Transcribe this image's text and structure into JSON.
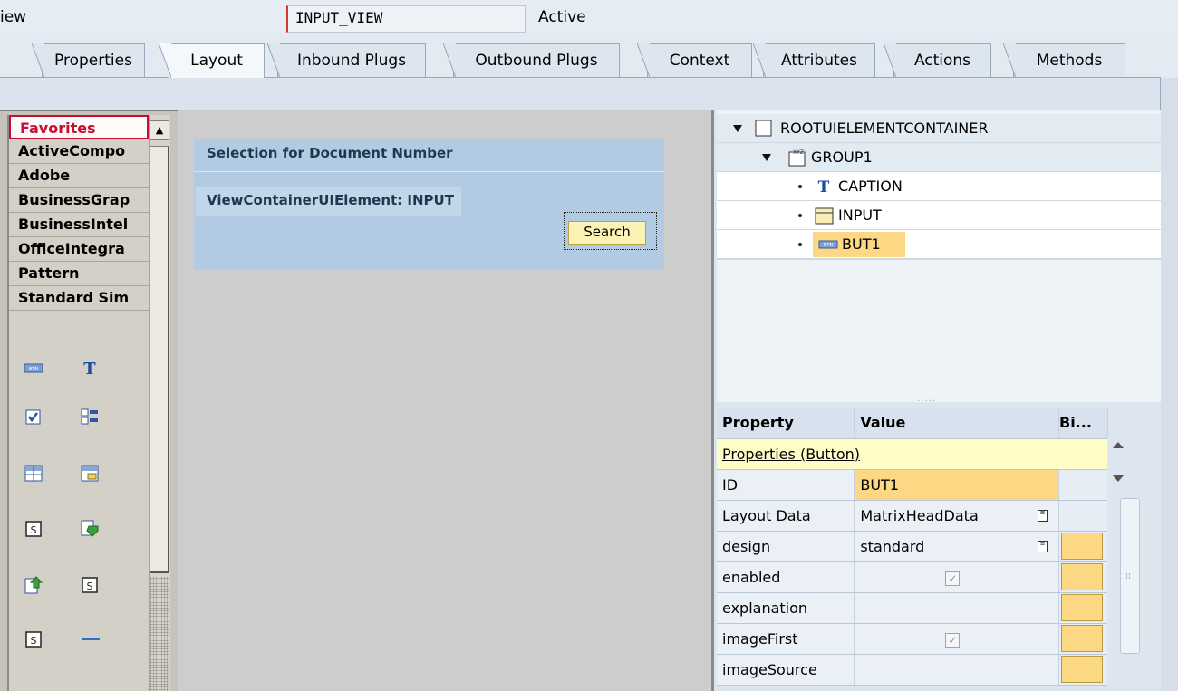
{
  "header": {
    "view_label": "iew",
    "view_name": "INPUT_VIEW",
    "status": "Active"
  },
  "tabs": [
    {
      "label": "Properties"
    },
    {
      "label": "Layout"
    },
    {
      "label": "Inbound Plugs"
    },
    {
      "label": "Outbound Plugs"
    },
    {
      "label": "Context"
    },
    {
      "label": "Attributes"
    },
    {
      "label": "Actions"
    },
    {
      "label": "Methods"
    }
  ],
  "active_tab": "Layout",
  "palette": {
    "categories": [
      {
        "label": "Favorites"
      },
      {
        "label": "ActiveCompo"
      },
      {
        "label": "Adobe"
      },
      {
        "label": "BusinessGrap"
      },
      {
        "label": "BusinessIntel"
      },
      {
        "label": "OfficeIntegra"
      },
      {
        "label": "Pattern"
      },
      {
        "label": "Standard Sim"
      }
    ],
    "icons": [
      "button-icon",
      "textview-icon",
      "checkbox-icon",
      "checkbox-group-icon",
      "table-icon",
      "tree-table-icon",
      "script-icon",
      "download-icon",
      "upload-icon",
      "script-icon",
      "script-icon",
      "separator-icon"
    ]
  },
  "canvas": {
    "group_title": "Selection for Document Number",
    "container_label": "ViewContainerUIElement: INPUT",
    "button_label": "Search"
  },
  "tree": {
    "nodes": [
      {
        "label": "ROOTUIELEMENTCONTAINER",
        "icon": "container-icon"
      },
      {
        "label": "GROUP1",
        "icon": "group-icon"
      },
      {
        "label": "CAPTION",
        "icon": "caption-icon"
      },
      {
        "label": "INPUT",
        "icon": "viewcontainer-icon"
      },
      {
        "label": "BUT1",
        "icon": "button-icon"
      }
    ],
    "selected": "BUT1"
  },
  "properties": {
    "headers": {
      "property": "Property",
      "value": "Value",
      "binding": "Bi..."
    },
    "section": "Properties (Button)",
    "rows": [
      {
        "property": "ID",
        "value": "BUT1"
      },
      {
        "property": "Layout Data",
        "value": "MatrixHeadData"
      },
      {
        "property": "design",
        "value": "standard"
      },
      {
        "property": "enabled",
        "value": "",
        "checked": true
      },
      {
        "property": "explanation",
        "value": ""
      },
      {
        "property": "imageFirst",
        "value": "",
        "checked": true
      },
      {
        "property": "imageSource",
        "value": ""
      }
    ]
  }
}
